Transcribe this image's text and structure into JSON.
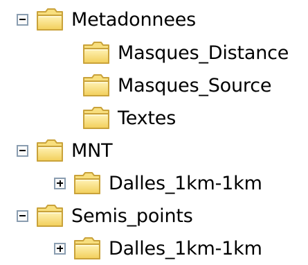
{
  "tree": {
    "items": [
      {
        "label": "Metadonnees",
        "toggle": "minus"
      },
      {
        "label": "Masques_Distance"
      },
      {
        "label": "Masques_Source"
      },
      {
        "label": "Textes"
      },
      {
        "label": "MNT",
        "toggle": "minus"
      },
      {
        "label": "Dalles_1km-1km",
        "toggle": "plus"
      },
      {
        "label": "Semis_points",
        "toggle": "minus"
      },
      {
        "label": "Dalles_1km-1km",
        "toggle": "plus"
      }
    ]
  },
  "icons": {
    "folder": "folder-icon",
    "expand": "plus-box-icon",
    "collapse": "minus-box-icon"
  },
  "colors": {
    "folder_fill": "#f1d86a",
    "folder_edge": "#c9a23a",
    "toggle_border": "#8a9db0"
  }
}
